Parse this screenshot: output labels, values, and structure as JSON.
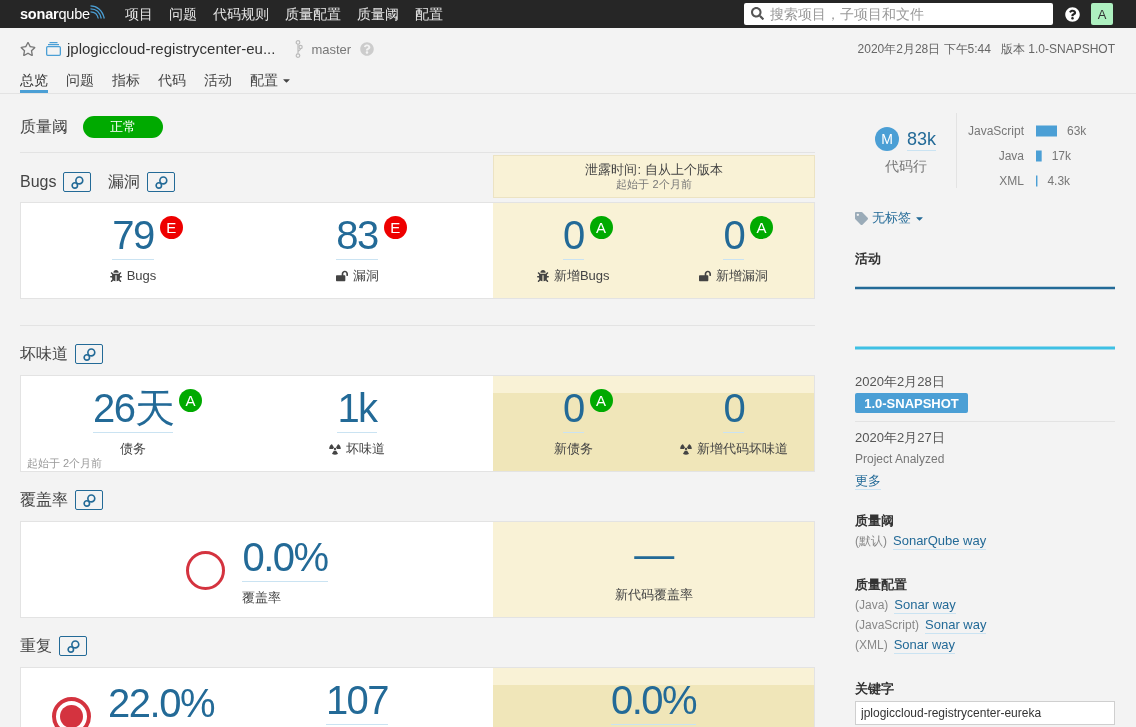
{
  "navbar": {
    "logo": "**sonar**qube",
    "menu": [
      {
        "label": "项目",
        "selected": false
      },
      {
        "label": "问题",
        "selected": false
      },
      {
        "label": "代码规则",
        "selected": false
      },
      {
        "label": "质量配置",
        "selected": false
      },
      {
        "label": "质量阈",
        "selected": false
      },
      {
        "label": "配置",
        "selected": false
      }
    ],
    "search": {
      "placeholder": "搜索项目，子项目和文件"
    },
    "avatar": "A"
  },
  "project": {
    "name": "jplogiccloud-registrycenter-eu...",
    "favorite": false,
    "branch": "master",
    "analysis_date": "2020年2月28日 下午5:44",
    "version": "版本 1.0-SNAPSHOT"
  },
  "tabs": [
    {
      "label": "总览",
      "selected": true,
      "kind": "link"
    },
    {
      "label": "问题",
      "selected": false,
      "kind": "link"
    },
    {
      "label": "指标",
      "selected": false,
      "kind": "link"
    },
    {
      "label": "代码",
      "selected": false,
      "kind": "link"
    },
    {
      "label": "活动",
      "selected": false,
      "kind": "link"
    },
    {
      "label": "配置",
      "selected": false,
      "kind": "menu"
    }
  ],
  "quality_gate": {
    "title": "质量阈",
    "status": "正常",
    "passed": true
  },
  "sections": [
    {
      "headings": [
        {
          "label": "Bugs"
        },
        {
          "label": "漏洞"
        }
      ],
      "leak_period": {
        "title": "泄露时间: 自从上个版本",
        "since": "起始于 2个月前"
      },
      "overall": [
        {
          "kind": "bug",
          "value": "79",
          "rating": {
            "text": "E",
            "color": "#ee0000"
          },
          "label": "Bugs"
        },
        {
          "kind": "vulnerability",
          "value": "83",
          "rating": {
            "text": "E",
            "color": "#ee0000"
          },
          "label": "漏洞"
        }
      ],
      "new_code": [
        {
          "kind": "bug",
          "value": "0",
          "rating": {
            "text": "A",
            "color": "#00aa00"
          },
          "label": "新增Bugs"
        },
        {
          "kind": "vulnerability",
          "value": "0",
          "rating": {
            "text": "A",
            "color": "#00aa00"
          },
          "label": "新增漏洞"
        }
      ],
      "shaded": false
    },
    {
      "headings": [
        {
          "label": "坏味道"
        }
      ],
      "overall": [
        {
          "kind": "debt",
          "value": "26**天**",
          "rating": {
            "text": "A",
            "color": "#00aa00"
          },
          "label": "债务"
        },
        {
          "kind": "smell",
          "value": "1k",
          "label": "坏味道"
        }
      ],
      "note": "起始于 2个月前",
      "new_code": [
        {
          "kind": "debt",
          "value": "0",
          "rating": {
            "text": "A",
            "color": "#00aa00"
          },
          "label": "新债务"
        },
        {
          "kind": "smell",
          "value": "0",
          "label": "新增代码坏味道"
        }
      ],
      "shaded": true
    },
    {
      "headings": [
        {
          "label": "覆盖率"
        }
      ],
      "overall": [
        {
          "kind": "coverage",
          "value": "0.0%",
          "label": "覆盖率"
        }
      ],
      "new_code": [
        {
          "kind": "empty",
          "value": "—",
          "label": "新代码覆盖率"
        }
      ],
      "shaded": false
    },
    {
      "headings": [
        {
          "label": "重复"
        }
      ],
      "overall": [
        {
          "kind": "duplication",
          "value": "22.0%"
        },
        {
          "kind": "count",
          "value": "107"
        }
      ],
      "new_code": [
        {
          "kind": "count",
          "value": "0.0%"
        }
      ],
      "shaded": true
    }
  ],
  "sidebar": {
    "size": {
      "rating": "M",
      "value": "83k",
      "label": "代码行"
    },
    "languages": {
      "chart_data": {
        "type": "bar",
        "orientation": "horizontal",
        "categories": [
          "JavaScript",
          "Java",
          "XML"
        ],
        "values": [
          63000,
          17000,
          4300
        ],
        "value_labels": [
          "63k",
          "17k",
          "4.3k"
        ]
      }
    },
    "tags": {
      "label": "无标签"
    },
    "activity": {
      "title": "活动",
      "events": [
        {
          "kind": "version",
          "date": "2020年2月28日",
          "text": "1.0-SNAPSHOT"
        },
        {
          "kind": "analysis",
          "date": "2020年2月27日",
          "text": "Project Analyzed"
        }
      ],
      "more": "更多"
    },
    "quality_gate": {
      "title": "质量阈",
      "prefix": "(默认)",
      "name": "SonarQube way"
    },
    "quality_profiles": {
      "title": "质量配置",
      "items": [
        {
          "language": "(Java)",
          "name": "Sonar way"
        },
        {
          "language": "(JavaScript)",
          "name": "Sonar way"
        },
        {
          "language": "(XML)",
          "name": "Sonar way"
        }
      ]
    },
    "key": {
      "title": "关键字",
      "value": "jplogiccloud-registrycenter-eureka"
    }
  }
}
